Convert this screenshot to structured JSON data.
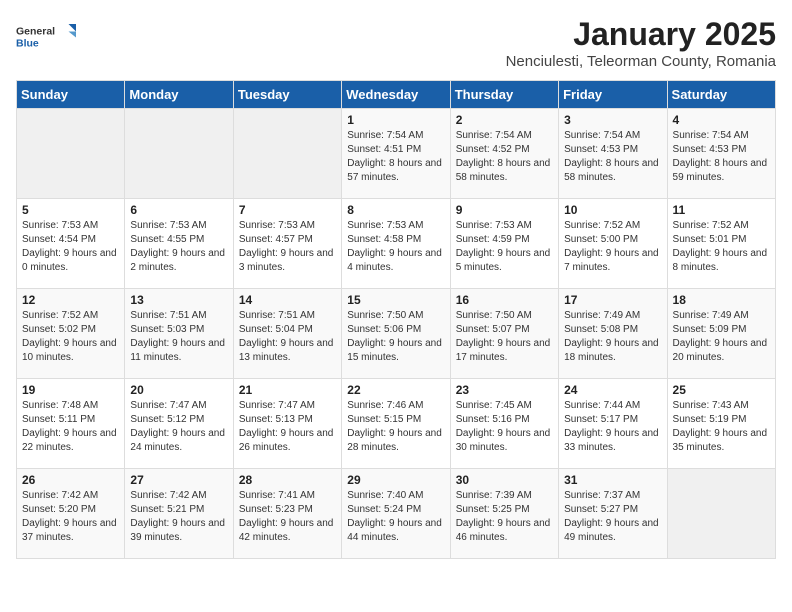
{
  "logo": {
    "text_general": "General",
    "text_blue": "Blue"
  },
  "title": "January 2025",
  "location": "Nenciulesti, Teleorman County, Romania",
  "weekdays": [
    "Sunday",
    "Monday",
    "Tuesday",
    "Wednesday",
    "Thursday",
    "Friday",
    "Saturday"
  ],
  "weeks": [
    [
      {
        "day": "",
        "sunrise": "",
        "sunset": "",
        "daylight": ""
      },
      {
        "day": "",
        "sunrise": "",
        "sunset": "",
        "daylight": ""
      },
      {
        "day": "",
        "sunrise": "",
        "sunset": "",
        "daylight": ""
      },
      {
        "day": "1",
        "sunrise": "Sunrise: 7:54 AM",
        "sunset": "Sunset: 4:51 PM",
        "daylight": "Daylight: 8 hours and 57 minutes."
      },
      {
        "day": "2",
        "sunrise": "Sunrise: 7:54 AM",
        "sunset": "Sunset: 4:52 PM",
        "daylight": "Daylight: 8 hours and 58 minutes."
      },
      {
        "day": "3",
        "sunrise": "Sunrise: 7:54 AM",
        "sunset": "Sunset: 4:53 PM",
        "daylight": "Daylight: 8 hours and 58 minutes."
      },
      {
        "day": "4",
        "sunrise": "Sunrise: 7:54 AM",
        "sunset": "Sunset: 4:53 PM",
        "daylight": "Daylight: 8 hours and 59 minutes."
      }
    ],
    [
      {
        "day": "5",
        "sunrise": "Sunrise: 7:53 AM",
        "sunset": "Sunset: 4:54 PM",
        "daylight": "Daylight: 9 hours and 0 minutes."
      },
      {
        "day": "6",
        "sunrise": "Sunrise: 7:53 AM",
        "sunset": "Sunset: 4:55 PM",
        "daylight": "Daylight: 9 hours and 2 minutes."
      },
      {
        "day": "7",
        "sunrise": "Sunrise: 7:53 AM",
        "sunset": "Sunset: 4:57 PM",
        "daylight": "Daylight: 9 hours and 3 minutes."
      },
      {
        "day": "8",
        "sunrise": "Sunrise: 7:53 AM",
        "sunset": "Sunset: 4:58 PM",
        "daylight": "Daylight: 9 hours and 4 minutes."
      },
      {
        "day": "9",
        "sunrise": "Sunrise: 7:53 AM",
        "sunset": "Sunset: 4:59 PM",
        "daylight": "Daylight: 9 hours and 5 minutes."
      },
      {
        "day": "10",
        "sunrise": "Sunrise: 7:52 AM",
        "sunset": "Sunset: 5:00 PM",
        "daylight": "Daylight: 9 hours and 7 minutes."
      },
      {
        "day": "11",
        "sunrise": "Sunrise: 7:52 AM",
        "sunset": "Sunset: 5:01 PM",
        "daylight": "Daylight: 9 hours and 8 minutes."
      }
    ],
    [
      {
        "day": "12",
        "sunrise": "Sunrise: 7:52 AM",
        "sunset": "Sunset: 5:02 PM",
        "daylight": "Daylight: 9 hours and 10 minutes."
      },
      {
        "day": "13",
        "sunrise": "Sunrise: 7:51 AM",
        "sunset": "Sunset: 5:03 PM",
        "daylight": "Daylight: 9 hours and 11 minutes."
      },
      {
        "day": "14",
        "sunrise": "Sunrise: 7:51 AM",
        "sunset": "Sunset: 5:04 PM",
        "daylight": "Daylight: 9 hours and 13 minutes."
      },
      {
        "day": "15",
        "sunrise": "Sunrise: 7:50 AM",
        "sunset": "Sunset: 5:06 PM",
        "daylight": "Daylight: 9 hours and 15 minutes."
      },
      {
        "day": "16",
        "sunrise": "Sunrise: 7:50 AM",
        "sunset": "Sunset: 5:07 PM",
        "daylight": "Daylight: 9 hours and 17 minutes."
      },
      {
        "day": "17",
        "sunrise": "Sunrise: 7:49 AM",
        "sunset": "Sunset: 5:08 PM",
        "daylight": "Daylight: 9 hours and 18 minutes."
      },
      {
        "day": "18",
        "sunrise": "Sunrise: 7:49 AM",
        "sunset": "Sunset: 5:09 PM",
        "daylight": "Daylight: 9 hours and 20 minutes."
      }
    ],
    [
      {
        "day": "19",
        "sunrise": "Sunrise: 7:48 AM",
        "sunset": "Sunset: 5:11 PM",
        "daylight": "Daylight: 9 hours and 22 minutes."
      },
      {
        "day": "20",
        "sunrise": "Sunrise: 7:47 AM",
        "sunset": "Sunset: 5:12 PM",
        "daylight": "Daylight: 9 hours and 24 minutes."
      },
      {
        "day": "21",
        "sunrise": "Sunrise: 7:47 AM",
        "sunset": "Sunset: 5:13 PM",
        "daylight": "Daylight: 9 hours and 26 minutes."
      },
      {
        "day": "22",
        "sunrise": "Sunrise: 7:46 AM",
        "sunset": "Sunset: 5:15 PM",
        "daylight": "Daylight: 9 hours and 28 minutes."
      },
      {
        "day": "23",
        "sunrise": "Sunrise: 7:45 AM",
        "sunset": "Sunset: 5:16 PM",
        "daylight": "Daylight: 9 hours and 30 minutes."
      },
      {
        "day": "24",
        "sunrise": "Sunrise: 7:44 AM",
        "sunset": "Sunset: 5:17 PM",
        "daylight": "Daylight: 9 hours and 33 minutes."
      },
      {
        "day": "25",
        "sunrise": "Sunrise: 7:43 AM",
        "sunset": "Sunset: 5:19 PM",
        "daylight": "Daylight: 9 hours and 35 minutes."
      }
    ],
    [
      {
        "day": "26",
        "sunrise": "Sunrise: 7:42 AM",
        "sunset": "Sunset: 5:20 PM",
        "daylight": "Daylight: 9 hours and 37 minutes."
      },
      {
        "day": "27",
        "sunrise": "Sunrise: 7:42 AM",
        "sunset": "Sunset: 5:21 PM",
        "daylight": "Daylight: 9 hours and 39 minutes."
      },
      {
        "day": "28",
        "sunrise": "Sunrise: 7:41 AM",
        "sunset": "Sunset: 5:23 PM",
        "daylight": "Daylight: 9 hours and 42 minutes."
      },
      {
        "day": "29",
        "sunrise": "Sunrise: 7:40 AM",
        "sunset": "Sunset: 5:24 PM",
        "daylight": "Daylight: 9 hours and 44 minutes."
      },
      {
        "day": "30",
        "sunrise": "Sunrise: 7:39 AM",
        "sunset": "Sunset: 5:25 PM",
        "daylight": "Daylight: 9 hours and 46 minutes."
      },
      {
        "day": "31",
        "sunrise": "Sunrise: 7:37 AM",
        "sunset": "Sunset: 5:27 PM",
        "daylight": "Daylight: 9 hours and 49 minutes."
      },
      {
        "day": "",
        "sunrise": "",
        "sunset": "",
        "daylight": ""
      }
    ]
  ]
}
